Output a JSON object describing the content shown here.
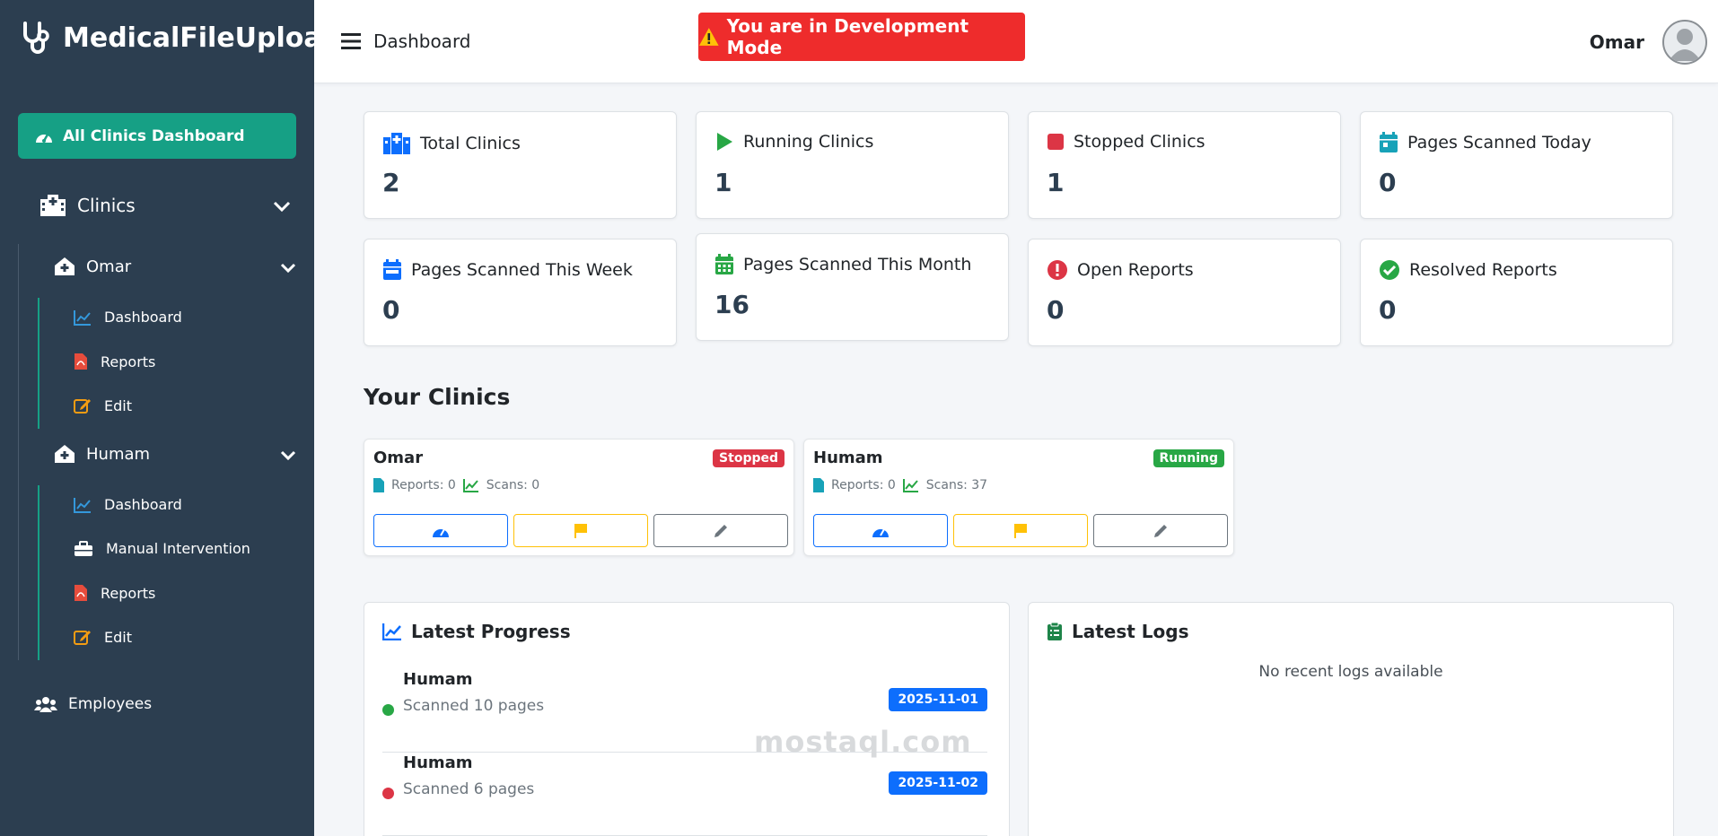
{
  "sidebar": {
    "brand": "MedicalFileUpload",
    "all_clinics": "All Clinics Dashboard",
    "clinics_label": "Clinics",
    "clinics": [
      {
        "name": "Omar",
        "items": [
          "Dashboard",
          "Reports",
          "Edit"
        ]
      },
      {
        "name": "Humam",
        "items": [
          "Dashboard",
          "Manual Intervention",
          "Reports",
          "Edit"
        ]
      }
    ],
    "employees": "Employees"
  },
  "topbar": {
    "title": "Dashboard",
    "dev_mode": "You are in Development Mode",
    "user": "Omar"
  },
  "stats": [
    {
      "label": "Total Clinics",
      "value": "2",
      "icon": "hospital-icon",
      "color": "#0d6efd"
    },
    {
      "label": "Running Clinics",
      "value": "1",
      "icon": "play-icon",
      "color": "#28a745"
    },
    {
      "label": "Stopped Clinics",
      "value": "1",
      "icon": "stop-icon",
      "color": "#dc3545"
    },
    {
      "label": "Pages Scanned Today",
      "value": "0",
      "icon": "calendar-day-icon",
      "color": "#17a2b8"
    },
    {
      "label": "Pages Scanned This Week",
      "value": "0",
      "icon": "calendar-week-icon",
      "color": "#0d6efd"
    },
    {
      "label": "Pages Scanned This Month",
      "value": "16",
      "icon": "calendar-month-icon",
      "color": "#28a745"
    },
    {
      "label": "Open Reports",
      "value": "0",
      "icon": "exclamation-circle-icon",
      "color": "#dc3545"
    },
    {
      "label": "Resolved Reports",
      "value": "0",
      "icon": "check-circle-icon",
      "color": "#28a745"
    }
  ],
  "your_clinics": {
    "title": "Your Clinics",
    "cards": [
      {
        "name": "Omar",
        "status": "Stopped",
        "status_color": "#dc3545",
        "reports": "Reports: 0",
        "scans": "Scans: 0"
      },
      {
        "name": "Humam",
        "status": "Running",
        "status_color": "#28a745",
        "reports": "Reports: 0",
        "scans": "Scans: 37"
      }
    ]
  },
  "latest_progress": {
    "title": "Latest Progress",
    "items": [
      {
        "name": "Humam",
        "desc": "Scanned 10 pages",
        "date": "2025-11-01",
        "dot_color": "#28a745"
      },
      {
        "name": "Humam",
        "desc": "Scanned 6 pages",
        "date": "2025-11-02",
        "dot_color": "#dc3545"
      }
    ]
  },
  "latest_logs": {
    "title": "Latest Logs",
    "empty": "No recent logs available"
  },
  "watermark": "mostaql.com"
}
